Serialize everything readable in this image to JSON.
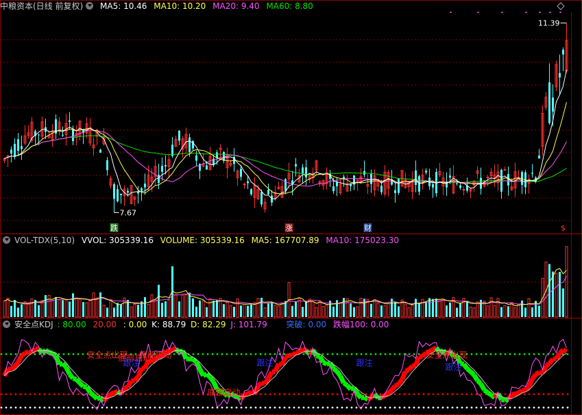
{
  "header_main": {
    "title": "中粮资本(日线 前复权)",
    "ma5": "MA5: 10.46",
    "ma10": "MA10: 10.20",
    "ma20": "MA20: 9.40",
    "ma60": "MA60: 8.80"
  },
  "header_vol": {
    "title": "VOL-TDX(5,10)",
    "vvol": "VVOL: 305339.16",
    "volume": "VOLUME: 305339.16",
    "ma5": "MA5: 167707.89",
    "ma10": "MA10: 175023.30"
  },
  "header_kdj": {
    "title": "安全点KDJ",
    "v80": ": 80.00",
    "v20": "20.00",
    "v0": ": 0.00",
    "k": "K: 88.79",
    "d": "D: 82.29",
    "j": "J: 101.79",
    "tupo": "突破: 0.00",
    "diefu": "跌幅100: 0.00"
  },
  "colors": {
    "up": "#ff3232",
    "down": "#54ffff",
    "ma5": "#ffffff",
    "ma10": "#ffff54",
    "ma20": "#ff54ff",
    "ma60": "#00e600",
    "kdj_red": "#ff0000",
    "kdj_green": "#00ee00",
    "grid": "#8a0000"
  },
  "chart_data": {
    "type": "candlestick",
    "y_main": [
      7.3,
      11.6
    ],
    "y_vol": [
      0,
      305339.16
    ],
    "y_kdj": [
      -5,
      115
    ],
    "price_labels": {
      "high": "11.39",
      "low": "7.67"
    },
    "signals": [
      {
        "label": "跌",
        "i": 32
      },
      {
        "label": "涨",
        "i": 83
      },
      {
        "label": "财",
        "i": 106
      },
      {
        "label": "$",
        "i": 163
      }
    ],
    "kdj_texts": [
      {
        "text": "安全点出现",
        "i": 30,
        "y": 88,
        "color": "#ff2020"
      },
      {
        "text": "底部启动",
        "i": 38,
        "y": 83,
        "color": "#ff2020"
      },
      {
        "text": "底部启动",
        "i": 44,
        "y": 88,
        "color": "#ff2020"
      },
      {
        "text": "跟注",
        "i": 37,
        "y": 76,
        "color": "#3030ff"
      },
      {
        "text": "底部启动",
        "i": 64,
        "y": 32,
        "color": "#ff2020"
      },
      {
        "text": "跟注",
        "i": 76,
        "y": 76,
        "color": "#3030ff"
      },
      {
        "text": "跟注",
        "i": 105,
        "y": 76,
        "color": "#3030ff"
      },
      {
        "text": "安全点出现",
        "i": 129,
        "y": 88,
        "color": "#ff2020"
      },
      {
        "text": "跟注",
        "i": 131,
        "y": 70,
        "color": "#3030ff"
      }
    ],
    "levels": [
      80,
      20,
      0
    ]
  }
}
